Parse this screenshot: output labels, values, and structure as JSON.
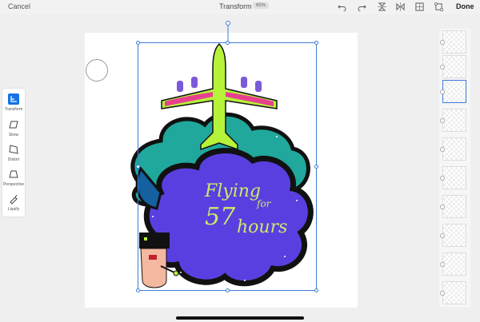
{
  "topbar": {
    "cancel_label": "Cancel",
    "title": "Transform",
    "zoom": "65%",
    "done_label": "Done"
  },
  "tools": [
    {
      "label": "Transform",
      "active": true
    },
    {
      "label": "Skew",
      "active": false
    },
    {
      "label": "Distort",
      "active": false
    },
    {
      "label": "Perspective",
      "active": false
    },
    {
      "label": "Liquify",
      "active": false
    }
  ],
  "artwork": {
    "text_line1": "Flying",
    "text_line2": "for",
    "text_line3": "57",
    "text_line4": "hours"
  },
  "colors": {
    "accent": "#1473e6",
    "selection": "#3d7dd8",
    "cloud_teal": "#1fa89b",
    "cloud_purple": "#5a3fe0",
    "plane_green": "#b6f23a"
  },
  "layers_count": 11,
  "active_layer_index": 2
}
